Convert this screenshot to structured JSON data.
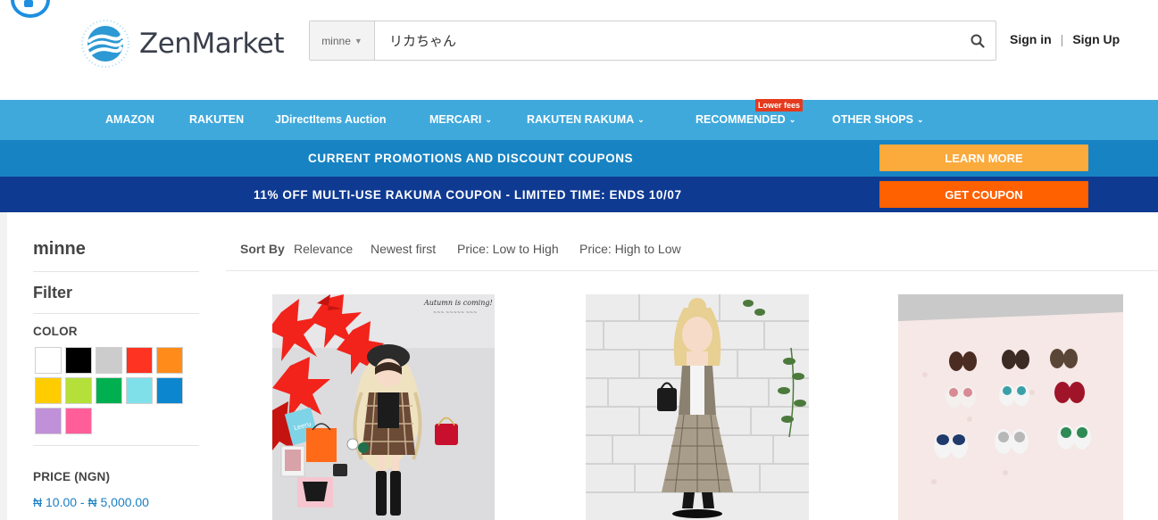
{
  "header": {
    "logo_text": "ZenMarket",
    "search": {
      "shop": "minne",
      "value": "リカちゃん"
    },
    "sign_in": "Sign in",
    "separator": "|",
    "sign_up": "Sign Up"
  },
  "nav": {
    "items": [
      {
        "label": "AMAZON"
      },
      {
        "label": "RAKUTEN"
      },
      {
        "label": "JDirectItems Auction"
      },
      {
        "label": "MERCARI"
      },
      {
        "label": "RAKUTEN RAKUMA"
      },
      {
        "label": "RECOMMENDED"
      },
      {
        "label": "OTHER SHOPS"
      }
    ],
    "badge": "Lower fees"
  },
  "promos": [
    {
      "text": "CURRENT PROMOTIONS AND DISCOUNT COUPONS",
      "button": "LEARN MORE",
      "button_color": "#fbaa3c"
    },
    {
      "text": "11% OFF MULTI-USE RAKUMA COUPON - LIMITED TIME: ENDS 10/07",
      "button": "GET COUPON",
      "button_color": "#ff6000"
    }
  ],
  "sidebar": {
    "shop_title": "minne",
    "filter_title": "Filter",
    "color_label": "COLOR",
    "colors": [
      "#ffffff",
      "#000000",
      "#cccccc",
      "#ff3322",
      "#ff8c1a",
      "#ffcc00",
      "#b5e03a",
      "#00b050",
      "#7fe0ea",
      "#0c86cf",
      "#c090d8",
      "#ff5e99"
    ],
    "price_label": "PRICE (NGN)",
    "price_range": "₦ 10.00 - ₦ 5,000.00"
  },
  "sort": {
    "label": "Sort By",
    "options": [
      "Relevance",
      "Newest first",
      "Price: Low to High",
      "Price: High to Low"
    ]
  },
  "photo_text": {
    "caption_line1": "Autumn is coming!",
    "shopping_bag": "Leeru"
  },
  "colors": {
    "nav_bg": "#3fa9dc",
    "promo1_bg": "#1783c3",
    "promo2_bg": "#0f3a91",
    "link": "#1a7fc4"
  }
}
